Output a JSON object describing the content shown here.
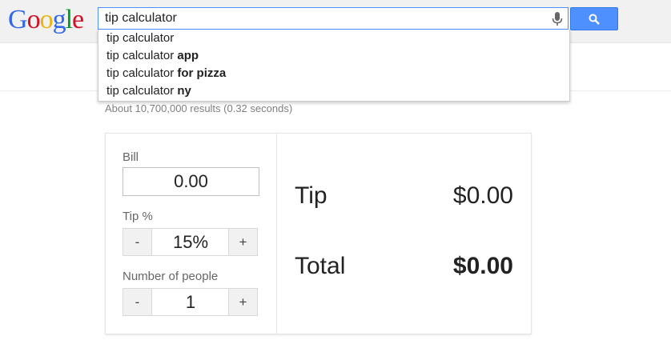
{
  "logo": {
    "letters": [
      "G",
      "o",
      "o",
      "g",
      "l",
      "e"
    ],
    "colors": [
      "#3369e8",
      "#d50f25",
      "#eeb211",
      "#3369e8",
      "#009925",
      "#d50f25"
    ]
  },
  "search": {
    "query": "tip calculator",
    "button_icon": "search-icon",
    "mic_icon": "microphone-icon"
  },
  "suggestions": [
    {
      "base": "tip calculator",
      "bold": ""
    },
    {
      "base": "tip calculator ",
      "bold": "app"
    },
    {
      "base": "tip calculator ",
      "bold": "for pizza"
    },
    {
      "base": "tip calculator ",
      "bold": "ny"
    }
  ],
  "results_stats": "About 10,700,000 results (0.32 seconds)",
  "calculator": {
    "bill_label": "Bill",
    "bill_value": "0.00",
    "tip_label": "Tip %",
    "tip_value": "15%",
    "people_label": "Number of people",
    "people_value": "1",
    "minus": "-",
    "plus": "+",
    "tip_result_label": "Tip",
    "tip_result_value": "$0.00",
    "total_label": "Total",
    "total_value": "$0.00"
  }
}
